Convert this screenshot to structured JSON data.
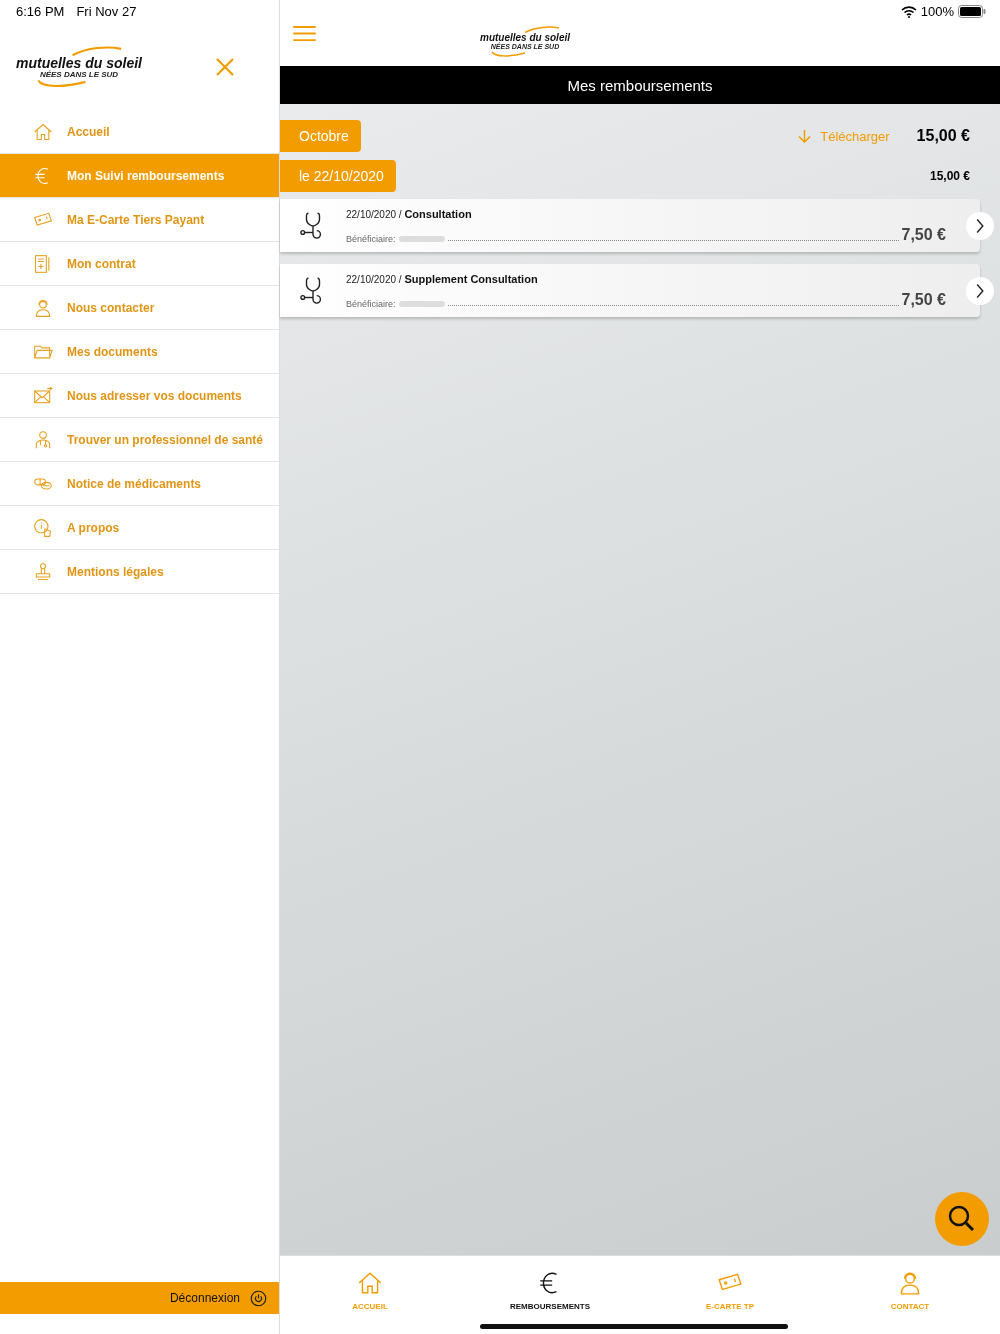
{
  "status_bar": {
    "time": "6:16 PM",
    "date": "Fri Nov 27",
    "battery": "100%"
  },
  "logo": {
    "name": "mutuelles du soleil",
    "tagline": "NÉES DANS LE SUD"
  },
  "header_logo": {
    "name": "mutuelles du soleil",
    "tagline": "NÉES DANS LE SUD"
  },
  "sidebar": {
    "items": [
      {
        "label": "Accueil",
        "selected": false
      },
      {
        "label": "Mon Suivi remboursements",
        "selected": true
      },
      {
        "label": "Ma E-Carte Tiers Payant",
        "selected": false
      },
      {
        "label": "Mon contrat",
        "selected": false
      },
      {
        "label": "Nous contacter",
        "selected": false
      },
      {
        "label": "Mes documents",
        "selected": false
      },
      {
        "label": "Nous adresser vos documents",
        "selected": false
      },
      {
        "label": "Trouver un professionnel de santé",
        "selected": false
      },
      {
        "label": "Notice de médicaments",
        "selected": false
      },
      {
        "label": "A propos",
        "selected": false
      },
      {
        "label": "Mentions légales",
        "selected": false
      }
    ],
    "logout": "Déconnexion"
  },
  "header": {
    "title": "Mes remboursements"
  },
  "month": {
    "label": "Octobre",
    "download": "Télécharger",
    "total": "15,00 €"
  },
  "day": {
    "label": "le 22/10/2020",
    "total": "15,00 €"
  },
  "entries": [
    {
      "date": "22/10/2020 /",
      "type": "Consultation",
      "beneficiary_label": "Bénéficiaire:",
      "amount": "7,50 €"
    },
    {
      "date": "22/10/2020 /",
      "type": "Supplement Consultation",
      "beneficiary_label": "Bénéficiaire:",
      "amount": "7,50 €"
    }
  ],
  "tabbar": [
    {
      "label": "ACCUEIL",
      "selected": false
    },
    {
      "label": "REMBOURSEMENTS",
      "selected": true
    },
    {
      "label": "E-CARTE TP",
      "selected": false
    },
    {
      "label": "CONTACT",
      "selected": false
    }
  ]
}
